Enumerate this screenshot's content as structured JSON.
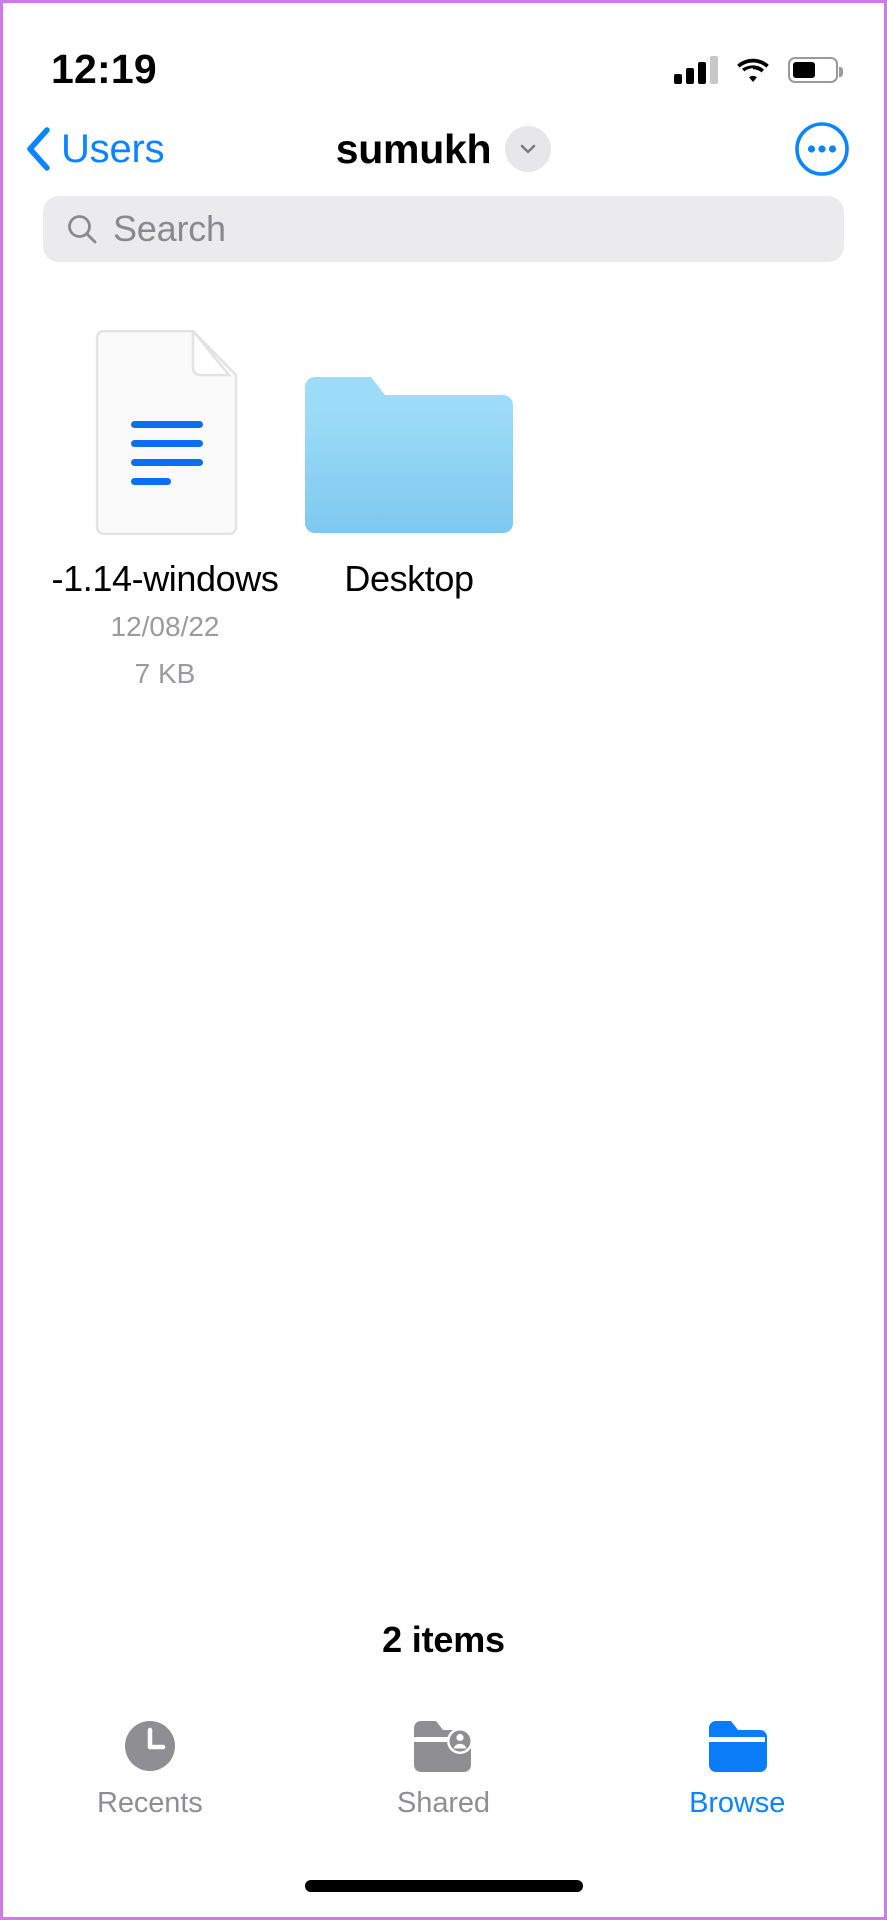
{
  "status_bar": {
    "time": "12:19",
    "signal_icon": "cellular-signal-icon",
    "signal_bars_filled": 3,
    "signal_bars_total": 4,
    "wifi_icon": "wifi-icon",
    "battery_icon": "battery-icon",
    "battery_level_percent": 55
  },
  "nav": {
    "back_label": "Users",
    "back_icon": "chevron-left-icon",
    "title": "sumukh",
    "caret_icon": "chevron-down-icon",
    "more_icon": "ellipsis-circle-icon"
  },
  "search": {
    "placeholder": "Search",
    "value": "",
    "icon": "search-icon"
  },
  "grid": {
    "items": [
      {
        "name": "-1.14-windows",
        "date": "12/08/22",
        "size": "7 KB",
        "icon": "document-icon",
        "type": "file"
      },
      {
        "name": "Desktop",
        "date": "",
        "size": "",
        "icon": "folder-icon",
        "type": "folder"
      }
    ]
  },
  "footer": {
    "item_count": "2 items"
  },
  "tabbar": {
    "tabs": [
      {
        "label": "Recents",
        "icon": "clock-icon",
        "active": false
      },
      {
        "label": "Shared",
        "icon": "folder-person-icon",
        "active": false
      },
      {
        "label": "Browse",
        "icon": "folder-filled-icon",
        "active": true
      }
    ]
  },
  "home_indicator": "home-indicator",
  "colors": {
    "accent_blue": "#0a84ff",
    "folder_blue": "#8ed2f5",
    "search_bg": "#ebebed",
    "muted_text": "#8e8e93",
    "device_border": "#cf7ae8"
  }
}
